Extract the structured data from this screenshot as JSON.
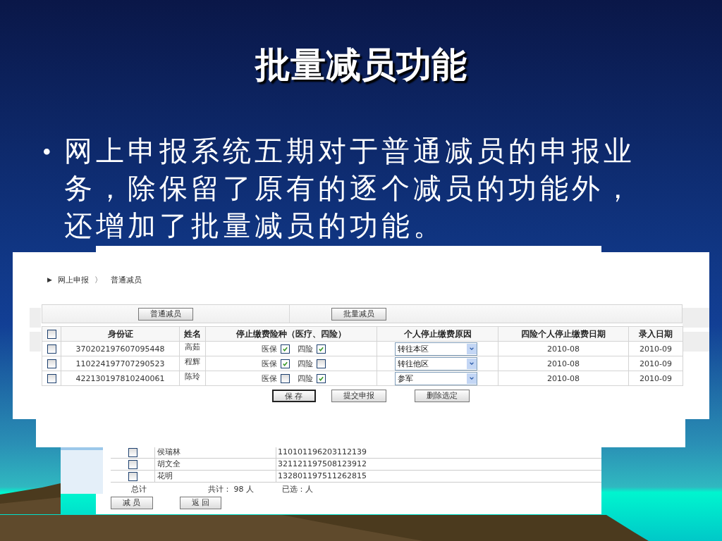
{
  "slide": {
    "title": "批量减员功能",
    "bullet": "•",
    "body": "网上申报系统五期对于普通减员的申报业务，除保留了原有的逐个减员的功能外，还增加了批量减员的功能。"
  },
  "list_screen": {
    "rows": [
      {
        "checked": false,
        "name": "侯瑞林",
        "id": "110101196203112139"
      },
      {
        "checked": false,
        "name": "胡文全",
        "id": "321121197508123912"
      },
      {
        "checked": false,
        "name": "花明",
        "id": "132801197511262815"
      }
    ],
    "summary": {
      "label": "总计",
      "total": "共计： 98 人",
      "chosen": "已选：人"
    },
    "buttons": [
      "减 员",
      "返 回"
    ]
  },
  "main_screen": {
    "breadcrumb": {
      "marker": "▶",
      "items": [
        "网上申报",
        "普通减员"
      ],
      "separator": "〉"
    },
    "mode_buttons": [
      "普通减员",
      "批量减员"
    ],
    "table": {
      "header_checkbox": {
        "checked": false
      },
      "columns": [
        "身份证",
        "姓名",
        "停止缴费险种（医疗、四险）",
        "个人停止缴费原因",
        "四险个人停止缴费日期",
        "录入日期"
      ],
      "rows": [
        {
          "checked": false,
          "id": "370202197607095448",
          "name": "高茹",
          "medical": {
            "label": "医保",
            "checked": true
          },
          "four": {
            "label": "四险",
            "checked": true
          },
          "reason": "转往本区",
          "stop_date": "2010-08",
          "entry_date": "2010-09"
        },
        {
          "checked": false,
          "id": "110224197707290523",
          "name": "程辉",
          "medical": {
            "label": "医保",
            "checked": true
          },
          "four": {
            "label": "四险",
            "checked": false
          },
          "reason": "转往他区",
          "stop_date": "2010-08",
          "entry_date": "2010-09"
        },
        {
          "checked": false,
          "id": "422130197810240061",
          "name": "陈玲",
          "medical": {
            "label": "医保",
            "checked": false
          },
          "four": {
            "label": "四险",
            "checked": true
          },
          "reason": "参军",
          "stop_date": "2010-08",
          "entry_date": "2010-09"
        }
      ]
    },
    "actions": [
      {
        "label": "保 存",
        "focused": true
      },
      {
        "label": "提交申报",
        "focused": false
      },
      {
        "label": "删除选定",
        "focused": false
      }
    ]
  }
}
